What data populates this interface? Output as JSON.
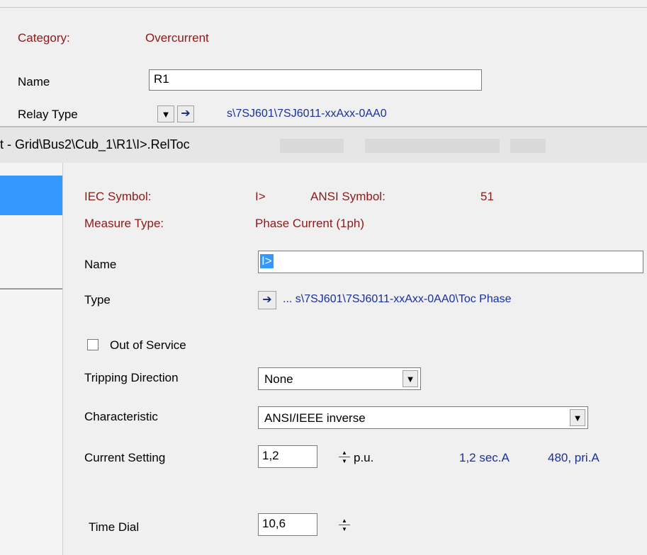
{
  "parent_dialog": {
    "category_label": "Category:",
    "category_value": "Overcurrent",
    "name_label": "Name",
    "name_value": "R1",
    "relay_type_label": "Relay Type",
    "relay_type_arrow": "▼",
    "relay_type_jump": "➔",
    "relay_type_value": "s\\7SJ601\\7SJ6011-xxAxx-0AA0"
  },
  "dialog": {
    "title": "t - Grid\\Bus2\\Cub_1\\R1\\I>.RelToc",
    "iec_symbol_label": "IEC Symbol:",
    "iec_symbol_value": "I>",
    "ansi_symbol_label": "ANSI Symbol:",
    "ansi_symbol_value": "51",
    "measure_type_label": "Measure Type:",
    "measure_type_value": "Phase Current (1ph)",
    "name_label": "Name",
    "name_value": "I>",
    "type_label": "Type",
    "type_jump": "➔",
    "type_value": "... s\\7SJ601\\7SJ6011-xxAxx-0AA0\\Toc Phase",
    "out_of_service_label": "Out of Service",
    "out_of_service_checked": false,
    "tripping_direction_label": "Tripping Direction",
    "tripping_direction_value": "None",
    "characteristic_label": "Characteristic",
    "characteristic_value": "ANSI/IEEE inverse",
    "current_setting_label": "Current Setting",
    "current_setting_value": "1,2",
    "current_setting_unit": "p.u.",
    "current_setting_sec": "1,2 sec.A",
    "current_setting_pri": "480, pri.A",
    "time_dial_label": "Time Dial",
    "time_dial_value": "10,6"
  },
  "icons": {
    "dropdown": "▼",
    "spin_up": "▲",
    "spin_down": "▼"
  },
  "colors": {
    "label_red": "#8b1a1a",
    "link_blue": "#1a2f9c",
    "selection_blue": "#3399ff"
  }
}
